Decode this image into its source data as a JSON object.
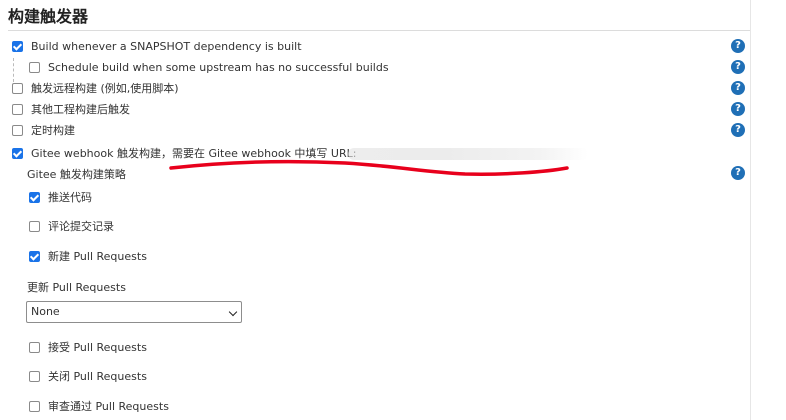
{
  "section_title": "构建触发器",
  "options": {
    "snapshot": {
      "label": "Build whenever a SNAPSHOT dependency is built",
      "checked": true
    },
    "upstream": {
      "label": "Schedule build when some upstream has no successful builds",
      "checked": false
    },
    "remote": {
      "label": "触发远程构建 (例如,使用脚本)",
      "checked": false
    },
    "after_other": {
      "label": "其他工程构建后触发",
      "checked": false
    },
    "timer": {
      "label": "定时构建",
      "checked": false
    },
    "gitee": {
      "label": "Gitee webhook 触发构建，需要在 Gitee webhook 中填写 URL:",
      "checked": true
    }
  },
  "gitee_strategy": {
    "title": "Gitee 触发构建策略",
    "push": {
      "label": "推送代码",
      "checked": true
    },
    "comment": {
      "label": "评论提交记录",
      "checked": false
    },
    "new_pr": {
      "label": "新建 Pull Requests",
      "checked": true
    },
    "update_pr_label": "更新 Pull Requests",
    "update_pr_select": {
      "value": "None"
    },
    "accept_pr": {
      "label": "接受 Pull Requests",
      "checked": false
    },
    "close_pr": {
      "label": "关闭 Pull Requests",
      "checked": false
    },
    "approve_pr": {
      "label": "审查通过 Pull Requests",
      "checked": false
    }
  },
  "help_glyph": "?",
  "colors": {
    "checkbox_checked": "#1a73e8",
    "help_icon": "#1f6fb6",
    "annotation": "#e8001c"
  }
}
